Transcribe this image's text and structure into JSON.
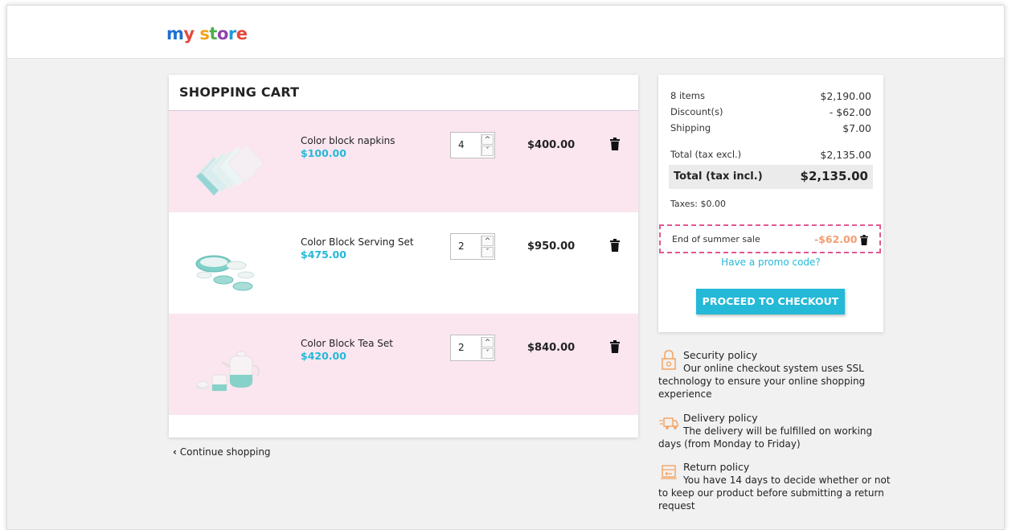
{
  "store": {
    "logo_text": "my store"
  },
  "cart": {
    "title": "SHOPPING CART",
    "items": [
      {
        "name": "Color block napkins",
        "unit_price": "$100.00",
        "quantity": "4",
        "total": "$400.00"
      },
      {
        "name": "Color Block Serving Set",
        "unit_price": "$475.00",
        "quantity": "2",
        "total": "$950.00"
      },
      {
        "name": "Color Block Tea Set",
        "unit_price": "$420.00",
        "quantity": "2",
        "total": "$840.00"
      }
    ],
    "continue_label": "Continue shopping"
  },
  "summary": {
    "items_label": "8 items",
    "items_value": "$2,190.00",
    "discount_label": "Discount(s)",
    "discount_value": "- $62.00",
    "shipping_label": "Shipping",
    "shipping_value": "$7.00",
    "total_excl_label": "Total (tax excl.)",
    "total_excl_value": "$2,135.00",
    "total_incl_label": "Total (tax incl.)",
    "total_incl_value": "$2,135.00",
    "taxes": "Taxes: $0.00",
    "voucher_name": "End of summer sale",
    "voucher_amount": "-$62.00",
    "promo_link": "Have a promo code?",
    "checkout_label": "PROCEED TO CHECKOUT"
  },
  "policies": [
    {
      "icon": "lock-icon",
      "title": "Security policy",
      "desc": "Our online checkout system uses SSL technology to ensure your online shopping experience"
    },
    {
      "icon": "delivery-truck-icon",
      "title": "Delivery policy",
      "desc": "The delivery will be fulfilled on working days (from Monday to Friday)"
    },
    {
      "icon": "return-box-icon",
      "title": "Return policy",
      "desc": "You have 14 days to decide whether or not to keep our product before submitting a return request"
    }
  ],
  "colors": {
    "accent": "#24b9d7",
    "row_highlight": "#fbe6f0",
    "voucher_border": "#e0588f",
    "voucher_amount": "#f39d72"
  }
}
